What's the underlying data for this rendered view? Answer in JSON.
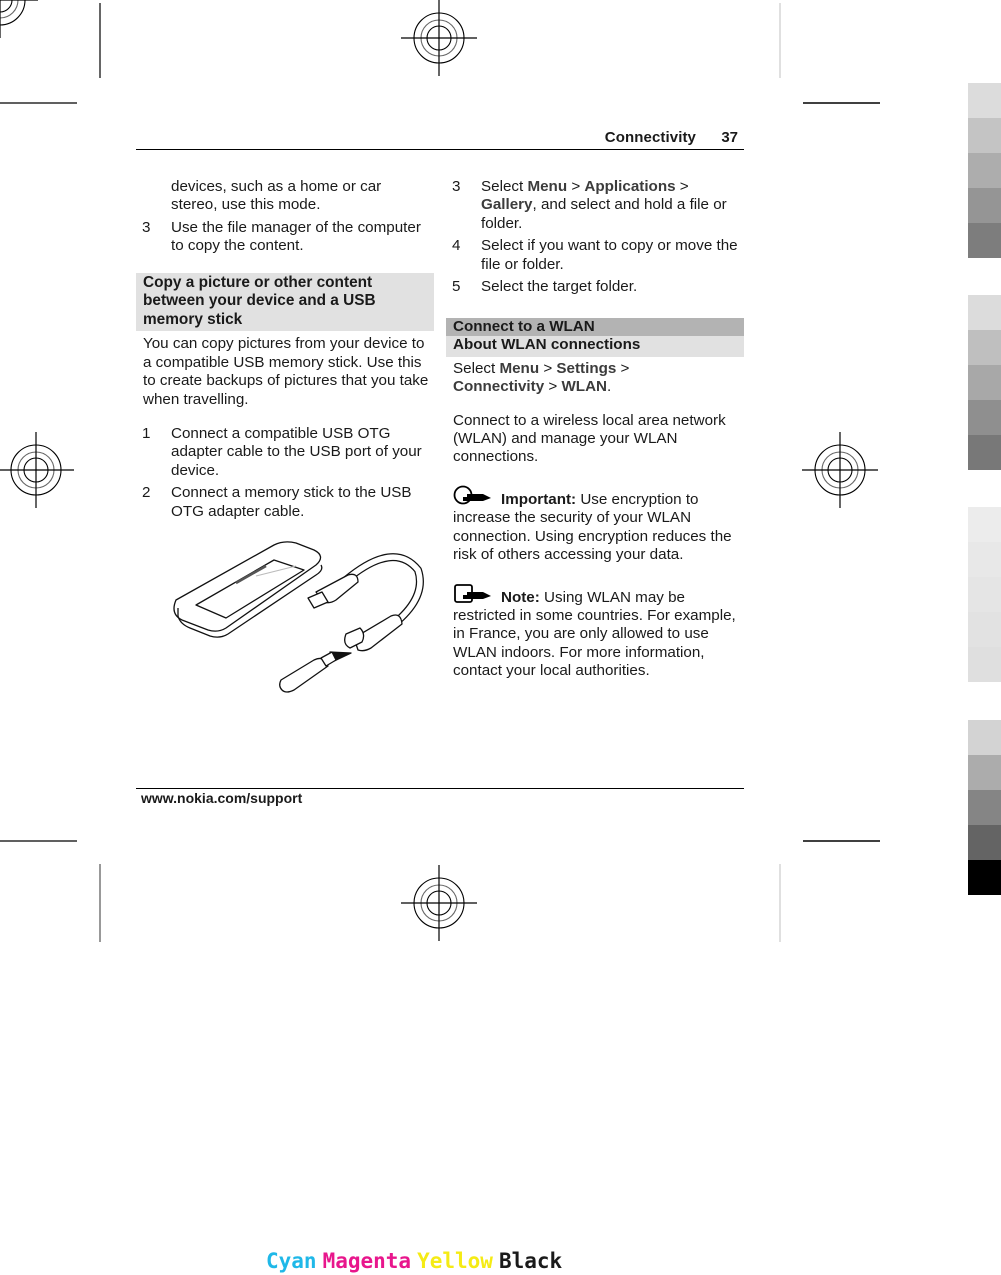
{
  "header": {
    "section_title": "Connectivity",
    "page_number": "37"
  },
  "left_column": {
    "continuation_lines": [
      "devices, such as a home or car",
      "stereo, use this mode."
    ],
    "continuation_text": "devices, such as a home or car stereo, use this mode.",
    "step3": {
      "number": "3",
      "text": "Use the file manager of the computer to copy the content."
    },
    "section_heading": "Copy a picture or other content between your device and a USB memory stick",
    "intro": "You can copy pictures from your device to a compatible USB memory stick. Use this to create backups of pictures that you take when travelling.",
    "steps": [
      {
        "number": "1",
        "text": "Connect a compatible USB OTG adapter cable to the USB port of your device."
      },
      {
        "number": "2",
        "text": "Connect a memory stick to the USB OTG adapter cable."
      }
    ],
    "illustration": "phone-usb-otg-memory-stick-illustration"
  },
  "right_column": {
    "steps": [
      {
        "number": "3",
        "prefix": "Select ",
        "menu": "Menu",
        "sep1": "  > ",
        "item1": "Applications",
        "sep2": "  > ",
        "item2": "Gallery",
        "suffix": ", and select and hold a file or folder."
      },
      {
        "number": "4",
        "text": "Select if you want to copy or move the file or folder."
      },
      {
        "number": "5",
        "text": "Select the target folder."
      }
    ],
    "section_heading": "Connect to a WLAN",
    "subsection_heading": "About WLAN connections",
    "path": {
      "prefix": "Select ",
      "menu": "Menu",
      "sep1": "  > ",
      "item1": "Settings",
      "sep2": "  > ",
      "item2": "Connectivity",
      "sep3": "  > ",
      "item3": "WLAN",
      "suffix": "."
    },
    "description": "Connect to a wireless local area network (WLAN) and manage your WLAN connections.",
    "important": {
      "icon": "important-pointing-hand-icon",
      "label": "Important:",
      "text": " Use encryption to increase the security of your WLAN connection. Using encryption reduces the risk of others accessing your data."
    },
    "note": {
      "icon": "note-pointing-hand-icon",
      "label": "Note:",
      "text": " Using WLAN may be restricted in some countries. For example, in France, you are only allowed to use WLAN indoors. For more information, contact your local authorities."
    }
  },
  "footer": {
    "url": "www.nokia.com/support"
  },
  "print_marks": {
    "color_bar_labels": [
      {
        "label": "Cyan",
        "color": "#1fb8e8"
      },
      {
        "label": "Magenta",
        "color": "#e8168c"
      },
      {
        "label": "Yellow",
        "color": "#f5eb14"
      },
      {
        "label": "Black",
        "color": "#1a1a1a"
      }
    ],
    "grey_swatches": [
      [
        "#dcdcdc",
        "#c4c4c4",
        "#adadad",
        "#959595",
        "#7d7d7d"
      ],
      [
        "#dcdcdc",
        "#bfbfbf",
        "#a8a8a8",
        "#8f8f8f",
        "#787878"
      ],
      [
        "#ececec",
        "#e8e8e8",
        "#e5e5e5",
        "#e2e2e2",
        "#dfdfdf"
      ],
      [
        "#d3d3d3",
        "#acacac",
        "#858585",
        "#646464",
        "#000000"
      ]
    ]
  }
}
